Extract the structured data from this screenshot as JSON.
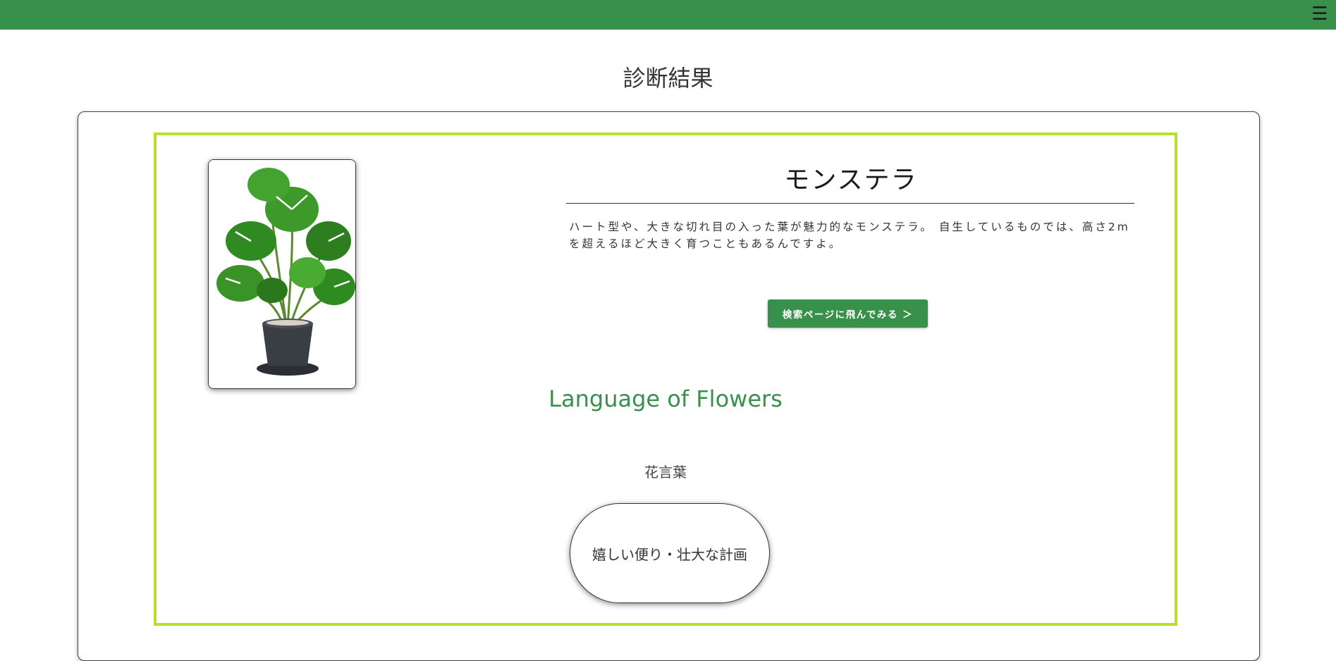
{
  "header": {
    "menu_icon": "hamburger-menu-icon",
    "color": "#37914a"
  },
  "page": {
    "title": "診断結果"
  },
  "result": {
    "plant_name": "モンステラ",
    "image_alt": "monstera-plant-photo",
    "description": "ハート型や、大きな切れ目の入った葉が魅力的なモンステラ。 自生しているものでは、高さ2mを超えるほど大きく育つこともあるんですよ。",
    "search_button_label": "検索ページに飛んでみる ＞",
    "language_heading": "Language of Flowers",
    "language_subheading": "花言葉",
    "flower_language": "嬉しい便り・壮大な計画"
  },
  "colors": {
    "accent_green": "#37914a",
    "frame_lime": "#b5e02c"
  }
}
